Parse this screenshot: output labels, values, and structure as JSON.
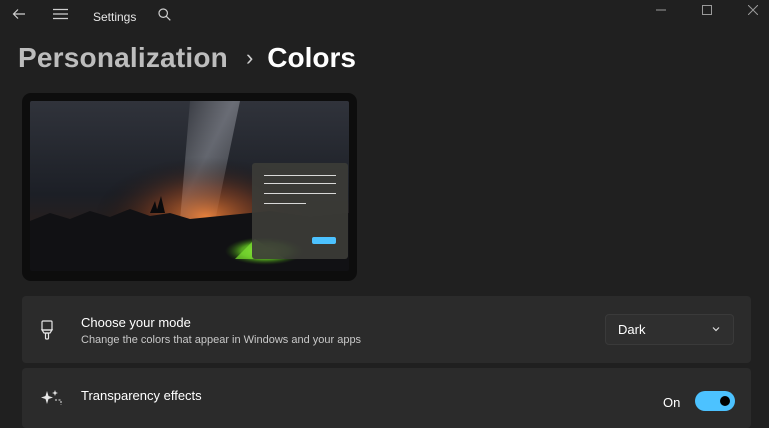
{
  "titlebar": {
    "app_title": "Settings",
    "back_icon": "back-arrow-icon",
    "menu_icon": "hamburger-menu-icon",
    "search_icon": "search-icon"
  },
  "window_controls": {
    "minimize_icon": "minimize-icon",
    "maximize_icon": "maximize-icon",
    "close_icon": "close-icon"
  },
  "breadcrumb": {
    "parent": "Personalization",
    "separator": "›",
    "current": "Colors"
  },
  "preview": {
    "accent_color": "#4cc2ff"
  },
  "settings": [
    {
      "icon": "paintbrush-icon",
      "title": "Choose your mode",
      "subtitle": "Change the colors that appear in Windows and your apps",
      "control": {
        "type": "dropdown",
        "value": "Dark"
      }
    },
    {
      "icon": "sparkle-icon",
      "title": "Transparency effects",
      "control": {
        "type": "toggle",
        "label": "On",
        "state": true
      }
    }
  ],
  "colors": {
    "background": "#202020",
    "card": "#2b2b2b",
    "accent": "#4cc2ff"
  }
}
